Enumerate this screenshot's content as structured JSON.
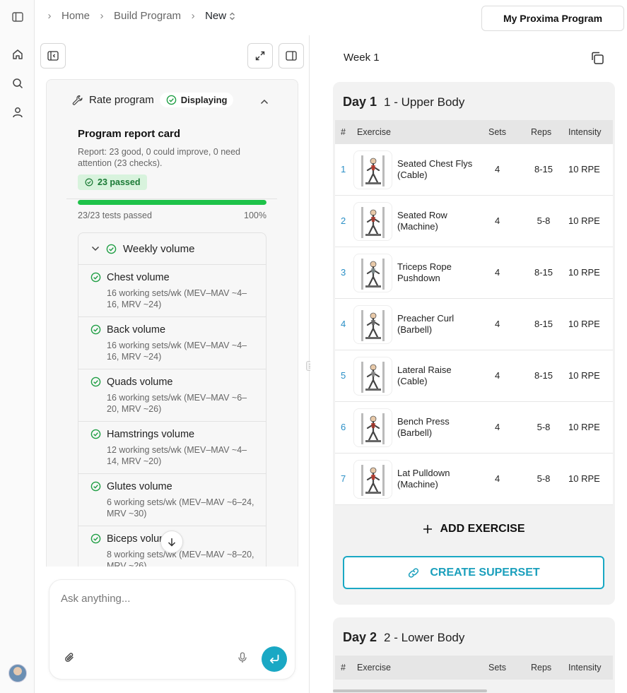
{
  "breadcrumb": {
    "items": [
      "Home",
      "Build Program"
    ],
    "current": "New"
  },
  "header": {
    "program_button": "My Proxima Program"
  },
  "rate": {
    "title": "Rate program",
    "status": "Displaying",
    "report_title": "Program report card",
    "report_text": "Report: 23 good, 0 could improve, 0 need attention (23 checks).",
    "passed_badge": "23 passed",
    "tests_passed": "23/23 tests passed",
    "percent": "100%",
    "progress": 1.0
  },
  "weekly_volume": {
    "title": "Weekly volume",
    "items": [
      {
        "name": "Chest volume",
        "desc": "16 working sets/wk (MEV–MAV ~4–16, MRV ~24)"
      },
      {
        "name": "Back volume",
        "desc": "16 working sets/wk (MEV–MAV ~4–16, MRV ~24)"
      },
      {
        "name": "Quads volume",
        "desc": "16 working sets/wk (MEV–MAV ~6–20, MRV ~26)"
      },
      {
        "name": "Hamstrings volume",
        "desc": "12 working sets/wk (MEV–MAV ~4–14, MRV ~20)"
      },
      {
        "name": "Glutes volume",
        "desc": "6 working sets/wk (MEV–MAV ~6–24, MRV ~30)"
      },
      {
        "name": "Biceps volume",
        "desc": "8 working sets/wk (MEV–MAV ~8–20, MRV ~26)"
      }
    ]
  },
  "chat": {
    "placeholder": "Ask anything..."
  },
  "week": {
    "title": "Week 1"
  },
  "table_headers": {
    "num": "#",
    "exercise": "Exercise",
    "sets": "Sets",
    "reps": "Reps",
    "intensity": "Intensity"
  },
  "days": [
    {
      "label": "Day 1",
      "name": "1 - Upper Body",
      "exercises": [
        {
          "num": "1",
          "name": "Seated Chest Flys (Cable)",
          "sets": "4",
          "reps": "8-15",
          "intensity": "10 RPE"
        },
        {
          "num": "2",
          "name": "Seated Row (Machine)",
          "sets": "4",
          "reps": "5-8",
          "intensity": "10 RPE"
        },
        {
          "num": "3",
          "name": "Triceps Rope Pushdown",
          "sets": "4",
          "reps": "8-15",
          "intensity": "10 RPE"
        },
        {
          "num": "4",
          "name": "Preacher Curl (Barbell)",
          "sets": "4",
          "reps": "8-15",
          "intensity": "10 RPE"
        },
        {
          "num": "5",
          "name": "Lateral Raise (Cable)",
          "sets": "4",
          "reps": "8-15",
          "intensity": "10 RPE"
        },
        {
          "num": "6",
          "name": "Bench Press (Barbell)",
          "sets": "4",
          "reps": "5-8",
          "intensity": "10 RPE"
        },
        {
          "num": "7",
          "name": "Lat Pulldown (Machine)",
          "sets": "4",
          "reps": "5-8",
          "intensity": "10 RPE"
        }
      ]
    },
    {
      "label": "Day 2",
      "name": "2 - Lower Body",
      "exercises": []
    }
  ],
  "actions": {
    "add_exercise": "ADD EXERCISE",
    "create_superset": "CREATE SUPERSET"
  },
  "colors": {
    "accent": "#1aa8c4",
    "success": "#1ec249",
    "link": "#2a8fc6"
  }
}
